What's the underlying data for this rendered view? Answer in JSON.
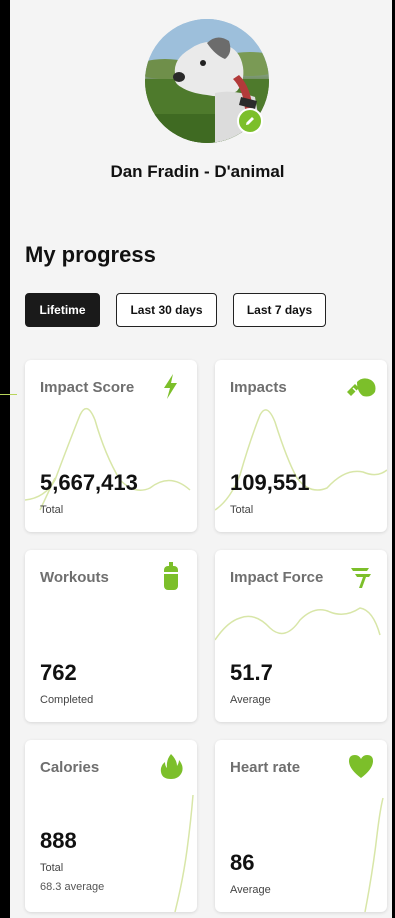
{
  "profile": {
    "name": "Dan Fradin - D'animal"
  },
  "progress": {
    "title": "My progress",
    "tabs": [
      {
        "label": "Lifetime",
        "active": true
      },
      {
        "label": "Last 30 days",
        "active": false
      },
      {
        "label": "Last 7 days",
        "active": false
      }
    ]
  },
  "cards": {
    "impact_score": {
      "title": "Impact Score",
      "value": "5,667,413",
      "sub": "Total",
      "icon": "lightning-icon"
    },
    "impacts": {
      "title": "Impacts",
      "value": "109,551",
      "sub": "Total",
      "icon": "boxing-glove-icon"
    },
    "workouts": {
      "title": "Workouts",
      "value": "762",
      "sub": "Completed",
      "icon": "punching-bag-icon"
    },
    "impact_force": {
      "title": "Impact Force",
      "value": "51.7",
      "sub": "Average",
      "icon": "running-figure-icon"
    },
    "calories": {
      "title": "Calories",
      "value": "888",
      "sub": "Total",
      "sub2": "68.3 average",
      "icon": "flame-icon"
    },
    "heart_rate": {
      "title": "Heart rate",
      "value": "86",
      "sub": "Average",
      "icon": "heart-icon"
    }
  },
  "colors": {
    "accent": "#7cbf2a",
    "sparkline": "#d8e6a8",
    "active_tab_bg": "#1a1a1a"
  }
}
